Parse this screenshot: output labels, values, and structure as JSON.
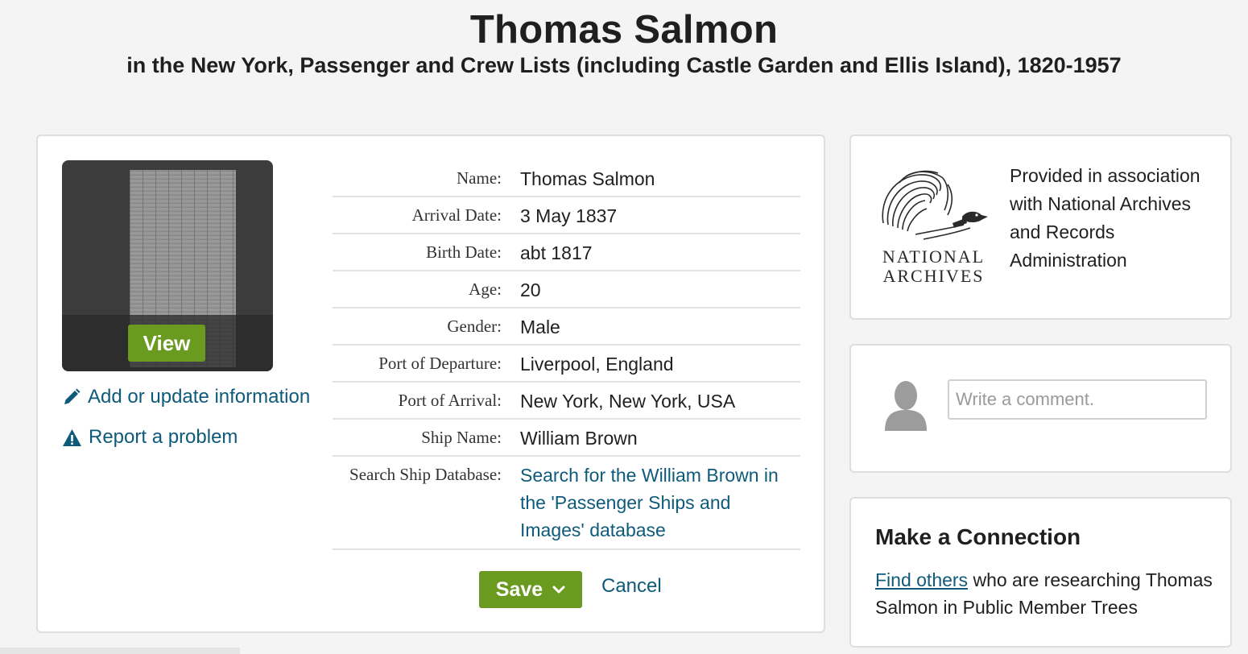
{
  "header": {
    "title": "Thomas Salmon",
    "subtitle": "in the New York, Passenger and Crew Lists (including Castle Garden and Ellis Island), 1820-1957"
  },
  "record": {
    "view_label": "View",
    "add_update_label": "Add or update information",
    "report_label": "Report a problem",
    "details": [
      {
        "label": "Name:",
        "value": "Thomas Salmon"
      },
      {
        "label": "Arrival Date:",
        "value": "3 May 1837"
      },
      {
        "label": "Birth Date:",
        "value": "abt 1817"
      },
      {
        "label": "Age:",
        "value": "20"
      },
      {
        "label": "Gender:",
        "value": "Male"
      },
      {
        "label": "Port of Departure:",
        "value": "Liverpool, England"
      },
      {
        "label": "Port of Arrival:",
        "value": "New York, New York, USA"
      },
      {
        "label": "Ship Name:",
        "value": "William Brown"
      },
      {
        "label": "Search Ship Database:",
        "value": "Search for the William Brown in the 'Passenger Ships and Images' database"
      }
    ],
    "save_label": "Save",
    "cancel_label": "Cancel"
  },
  "provider": {
    "logo_text_line1": "NATIONAL",
    "logo_text_line2": "ARCHIVES",
    "text": "Provided in association with National Archives and Records Administration"
  },
  "comment": {
    "placeholder": "Write a comment."
  },
  "connection": {
    "title": "Make a Connection",
    "link_text": "Find others",
    "text_after": " who are researching Thomas Salmon in Public Member Trees"
  },
  "colors": {
    "accent_green": "#6a9a1f",
    "link_blue": "#0e5a7a"
  },
  "icons": [
    "pencil-icon",
    "warning-icon",
    "chevron-down-icon",
    "eagle-logo-icon",
    "avatar-icon"
  ]
}
